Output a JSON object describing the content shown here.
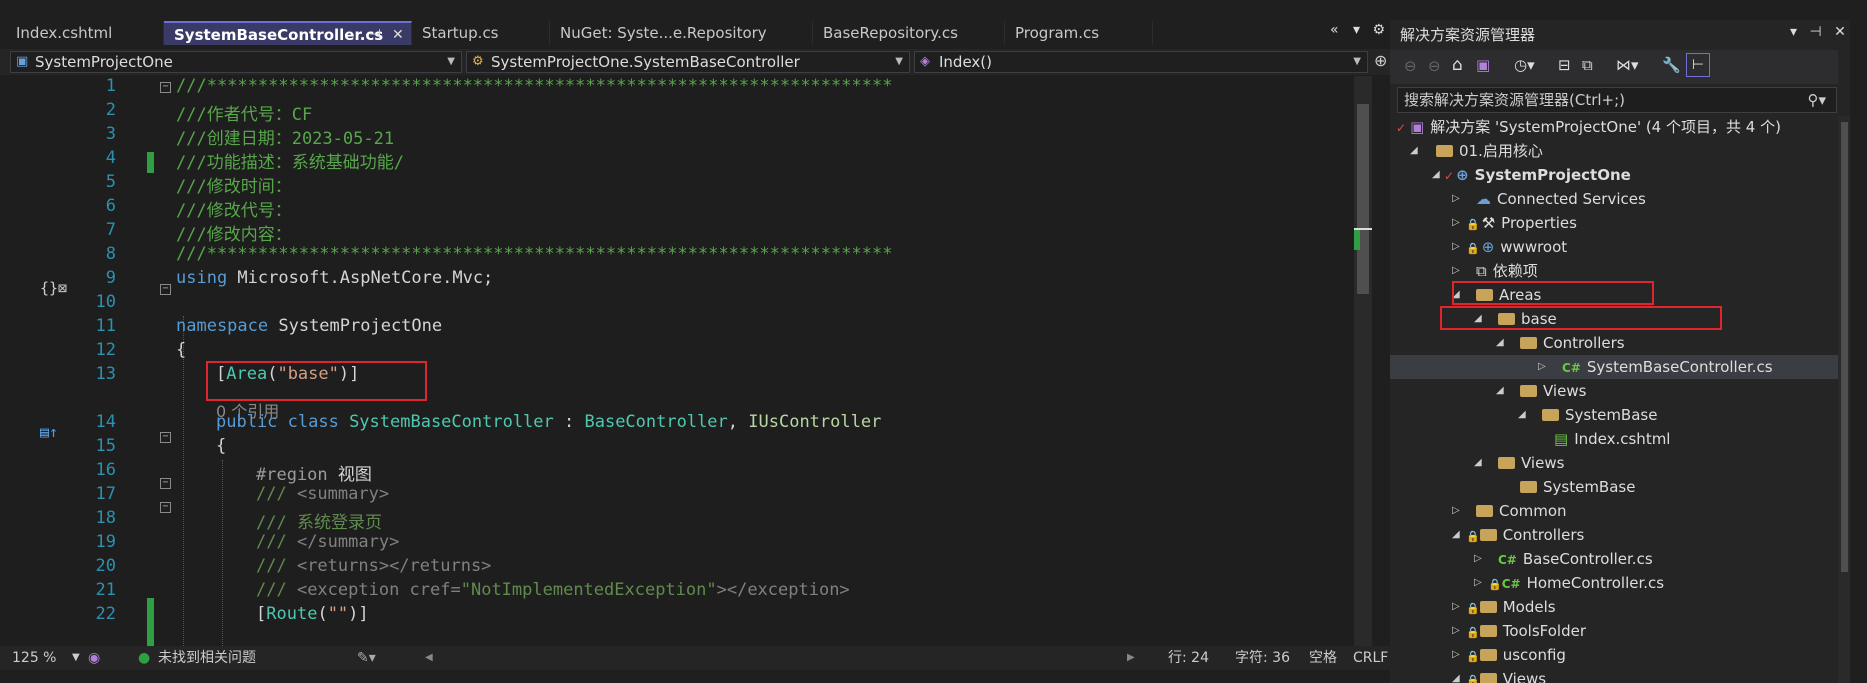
{
  "tabs": [
    {
      "label": "Index.cshtml"
    },
    {
      "label": "SystemBaseController.cs",
      "active": true
    },
    {
      "label": "Startup.cs"
    },
    {
      "label": "NuGet: Syste...e.Repository"
    },
    {
      "label": "BaseRepository.cs"
    },
    {
      "label": "Program.cs"
    }
  ],
  "navbar": {
    "project": "SystemProjectOne",
    "class": "SystemProjectOne.SystemBaseController",
    "member": "Index()"
  },
  "editor": {
    "line_numbers": [
      "1",
      "2",
      "3",
      "4",
      "5",
      "6",
      "7",
      "8",
      "9",
      "10",
      "11",
      "12",
      "13",
      "14",
      "15",
      "16",
      "17",
      "18",
      "19",
      "20",
      "21",
      "22"
    ],
    "lines": {
      "l1": "///*******************************************************************",
      "l2": "///作者代号：CF",
      "l3": "///创建日期：2023-05-21",
      "l4": "///功能描述：系统基础功能/",
      "l5": "///修改时间：",
      "l6": "///修改代号：",
      "l7": "///修改内容：",
      "l8": "///*******************************************************************",
      "l9_kw": "using",
      "l9_rest": " Microsoft.AspNetCore.Mvc;",
      "l11_kw": "namespace",
      "l11_rest": " SystemProjectOne",
      "l12": "{",
      "l13_a": "[",
      "l13_type": "Area",
      "l13_b": "(",
      "l13_str": "\"base\"",
      "l13_c": ")]",
      "codelens": "0 个引用",
      "l14_kw": "public class",
      "l14_name": " SystemBaseController",
      "l14_sep": " : ",
      "l14_base": "BaseController",
      "l14_comma": ", ",
      "l14_iface": "IUsController",
      "l15": "{",
      "l16_kw": "#region",
      "l16_rest": " 视图",
      "l17_a": "/// ",
      "l17_tag": "<summary>",
      "l18": "/// 系统登录页",
      "l19_a": "/// ",
      "l19_tag": "</summary>",
      "l20_a": "/// ",
      "l20_tag": "<returns></returns>",
      "l21_a": "/// ",
      "l21_tag1": "<exception ",
      "l21_attr": "cref=",
      "l21_val": "\"NotImplementedException\"",
      "l21_tag2": "></exception>",
      "l22_a": "[",
      "l22_type": "Route",
      "l22_b": "(",
      "l22_str": "\"\"",
      "l22_c": ")]"
    }
  },
  "status": {
    "zoom": "125 %",
    "issues": "未找到相关问题",
    "line": "行: 24",
    "char": "字符: 36",
    "indent": "空格",
    "eol": "CRLF"
  },
  "solution_explorer": {
    "title": "解决方案资源管理器",
    "search_placeholder": "搜索解决方案资源管理器(Ctrl+;)",
    "nodes": [
      {
        "label": "解决方案 'SystemProjectOne' (4 个项目，共 4 个)"
      },
      {
        "label": "01.启用核心"
      },
      {
        "label": "SystemProjectOne"
      },
      {
        "label": "Connected Services"
      },
      {
        "label": "Properties"
      },
      {
        "label": "wwwroot"
      },
      {
        "label": "依赖项"
      },
      {
        "label": "Areas"
      },
      {
        "label": "base"
      },
      {
        "label": "Controllers"
      },
      {
        "label": "SystemBaseController.cs"
      },
      {
        "label": "Views"
      },
      {
        "label": "SystemBase"
      },
      {
        "label": "Index.cshtml"
      },
      {
        "label": "Views"
      },
      {
        "label": "SystemBase"
      },
      {
        "label": "Common"
      },
      {
        "label": "Controllers"
      },
      {
        "label": "BaseController.cs"
      },
      {
        "label": "HomeController.cs"
      },
      {
        "label": "Models"
      },
      {
        "label": "ToolsFolder"
      },
      {
        "label": "usconfig"
      },
      {
        "label": "Views"
      }
    ]
  },
  "colors": {
    "highlight_box": "#e0262c",
    "active_tab": "#3a3a66"
  }
}
